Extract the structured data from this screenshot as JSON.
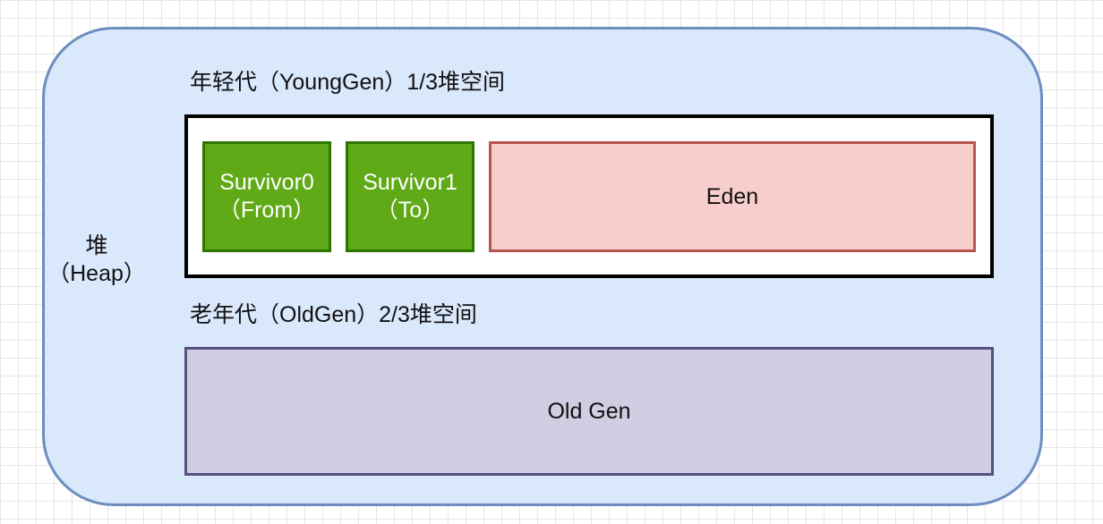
{
  "heap": {
    "label_line1": "堆",
    "label_line2": "（Heap）"
  },
  "young_gen": {
    "title": "年轻代（YoungGen）1/3堆空间",
    "survivor0": {
      "line1": "Survivor0",
      "line2": "（From）"
    },
    "survivor1": {
      "line1": "Survivor1",
      "line2": "（To）"
    },
    "eden": "Eden"
  },
  "old_gen": {
    "title": "老年代（OldGen）2/3堆空间",
    "box_label": "Old Gen"
  },
  "colors": {
    "heap_fill": "#dae8fc",
    "heap_stroke": "#6c8ebf",
    "survivor_fill": "#60a917",
    "survivor_stroke": "#2d7600",
    "eden_fill": "#f8cecc",
    "eden_stroke": "#b85450",
    "oldgen_fill": "#d0cee2",
    "oldgen_stroke": "#56517e"
  }
}
